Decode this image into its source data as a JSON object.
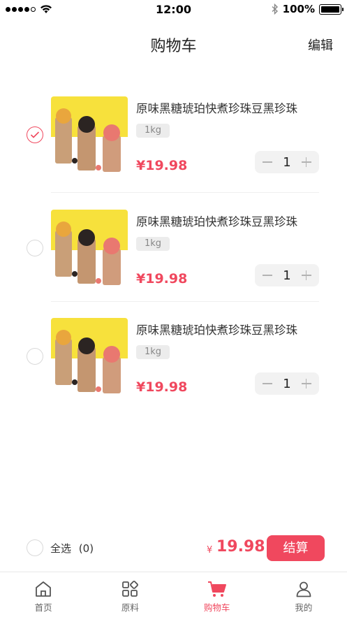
{
  "status_bar": {
    "time": "12:00",
    "battery": "100%"
  },
  "header": {
    "title": "购物车",
    "edit_label": "编辑"
  },
  "colors": {
    "accent": "#f0485e",
    "divider": "#efefef"
  },
  "cart": {
    "items": [
      {
        "name": "原味黑糖琥珀快煮珍珠豆黑珍珠",
        "spec": "1kg",
        "price": "¥19.98",
        "quantity": "1",
        "selected": true
      },
      {
        "name": "原味黑糖琥珀快煮珍珠豆黑珍珠",
        "spec": "1kg",
        "price": "¥19.98",
        "quantity": "1",
        "selected": false
      },
      {
        "name": "原味黑糖琥珀快煮珍珠豆黑珍珠",
        "spec": "1kg",
        "price": "¥19.98",
        "quantity": "1",
        "selected": false
      }
    ]
  },
  "footer": {
    "select_all_label": "全选",
    "select_count": "(0)",
    "currency": "¥",
    "total": "19.98",
    "checkout_label": "结算"
  },
  "tabbar": {
    "tabs": [
      {
        "label": "首页",
        "icon": "home-icon",
        "active": false
      },
      {
        "label": "原料",
        "icon": "grid-icon",
        "active": false
      },
      {
        "label": "购物车",
        "icon": "cart-icon",
        "active": true
      },
      {
        "label": "我的",
        "icon": "user-icon",
        "active": false
      }
    ]
  }
}
